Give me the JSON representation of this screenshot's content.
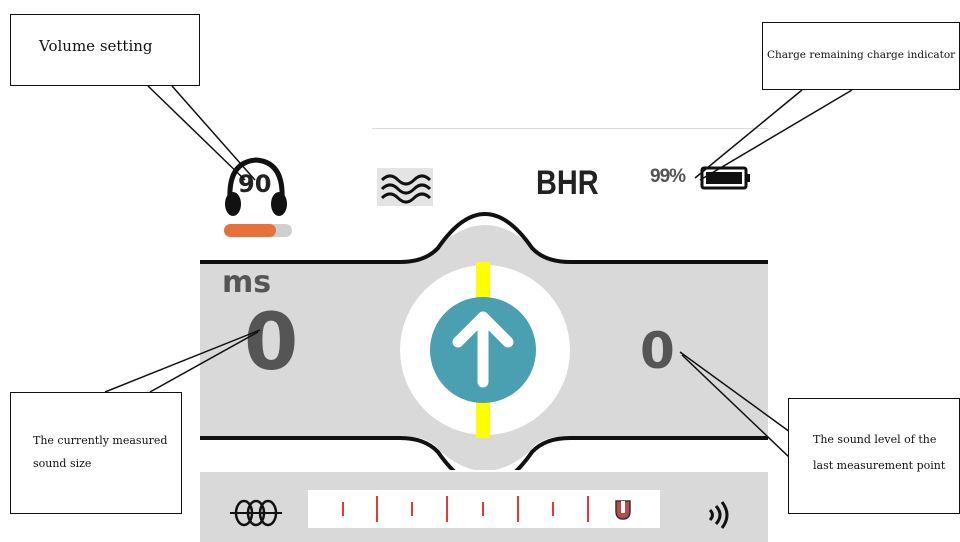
{
  "device": {
    "volume_value": "90",
    "band_label": "BHR",
    "battery_text": "99%",
    "unit_label": "ms",
    "current_value": "0",
    "last_value": "0",
    "colors": {
      "panel": "#d9d9d9",
      "arrow_circle": "#4a9fb1",
      "needle": "#ffff00",
      "volume_bar": "#e8703a",
      "ticks": "#e53935"
    },
    "icons": [
      "headphones-icon",
      "waves-icon",
      "battery-icon",
      "up-arrow-icon",
      "coil-icon",
      "signal-icon"
    ]
  },
  "callouts": {
    "volume": "Volume setting",
    "charge": "Charge remaining charge indicator",
    "current": "The currently measured sound size",
    "last": "The sound level of the last measurement point"
  }
}
